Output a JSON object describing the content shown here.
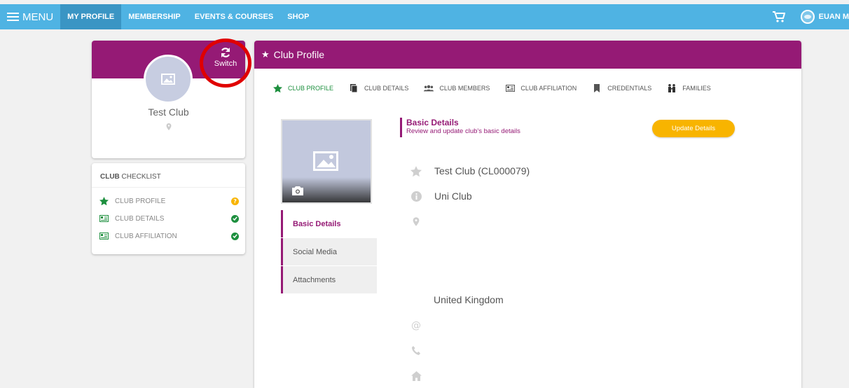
{
  "nav": {
    "menu_label": "MENU",
    "links": [
      "MY PROFILE",
      "MEMBERSHIP",
      "EVENTS & COURSES",
      "SHOP"
    ],
    "user_name": "EUAN M"
  },
  "profile_card": {
    "switch_label": "Switch",
    "club_name": "Test Club"
  },
  "checklist": {
    "title_bold": "CLUB",
    "title_rest": " CHECKLIST",
    "items": [
      {
        "label": "CLUB PROFILE",
        "status": "pending"
      },
      {
        "label": "CLUB DETAILS",
        "status": "done"
      },
      {
        "label": "CLUB AFFILIATION",
        "status": "done"
      }
    ]
  },
  "main": {
    "header_title": "Club Profile",
    "tabs": [
      "CLUB PROFILE",
      "CLUB DETAILS",
      "CLUB MEMBERS",
      "CLUB AFFILIATION",
      "CREDENTIALS",
      "FAMILIES"
    ],
    "side_menu": [
      "Basic Details",
      "Social Media",
      "Attachments"
    ],
    "section_title": "Basic Details",
    "section_subtitle": "Review and update club's basic details",
    "update_button": "Update Details",
    "club_full_name": "Test Club (CL000079)",
    "club_type": "Uni Club",
    "country": "United Kingdom"
  },
  "colors": {
    "nav_blue": "#4fb3e3",
    "nav_active": "#3a95c4",
    "brand_purple": "#951a75",
    "accent_yellow": "#f8b400",
    "success_green": "#1d8f3e",
    "highlight_red": "#e00000"
  }
}
